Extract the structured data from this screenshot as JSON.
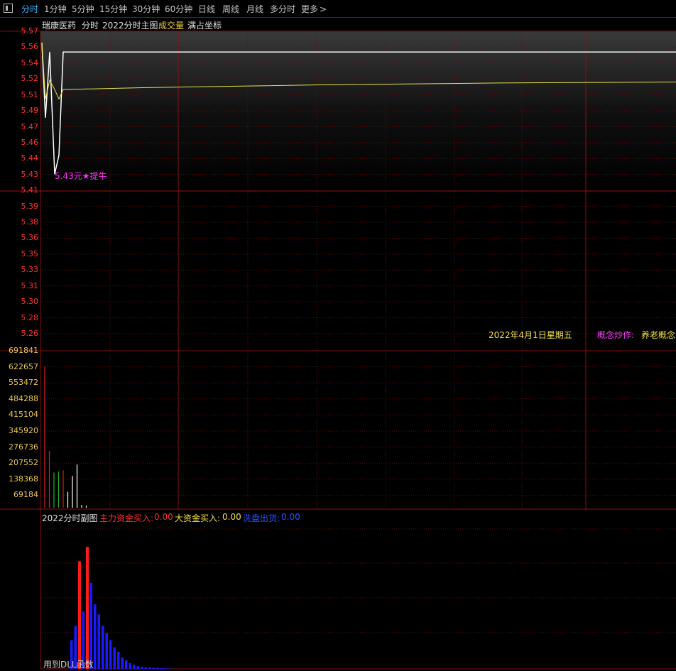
{
  "toolbar": {
    "items": [
      {
        "label": "分时",
        "active": true
      },
      {
        "label": "1分钟"
      },
      {
        "label": "5分钟"
      },
      {
        "label": "15分钟"
      },
      {
        "label": "30分钟"
      },
      {
        "label": "60分钟"
      },
      {
        "label": "日线"
      },
      {
        "label": "周线"
      },
      {
        "label": "月线"
      },
      {
        "label": "多分时"
      },
      {
        "label": "更多"
      }
    ],
    "more_icon": "chevron-right-icon",
    "menu_icon": "window-icon"
  },
  "main_chart": {
    "stock_name": "瑞康医药",
    "mode": "分时",
    "indicator": "2022分时主图",
    "volume_label": "成交量",
    "scale_label": "满占坐标",
    "price_ticks": [
      "5.57",
      "5.56",
      "5.54",
      "5.52",
      "5.51",
      "5.49",
      "5.47",
      "5.46",
      "5.44",
      "5.43",
      "5.41",
      "5.39",
      "5.38",
      "5.36",
      "5.35",
      "5.33",
      "5.31",
      "5.30",
      "5.28",
      "5.26"
    ],
    "low_annotation": "5.43元★提牛",
    "date_text": "2022年4月1日星期五",
    "concept_label": "概念炒作:",
    "concept_value": "养老概念"
  },
  "volume_chart": {
    "ticks": [
      "691841",
      "622657",
      "553472",
      "484288",
      "415104",
      "345920",
      "276736",
      "207552",
      "138368",
      "69184"
    ]
  },
  "sub_chart": {
    "title": "2022分时副图",
    "main_label": "主力资金买入:",
    "main_value": "0.00",
    "big_label": "大资金买入:",
    "big_value": "0.00",
    "wash_label": "洗盘出货:",
    "wash_value": "0.00",
    "footer_text": "用到DLL函数"
  },
  "chart_data": [
    {
      "type": "line",
      "series": [
        {
          "values": [
            5.57,
            5.49,
            5.56,
            5.43,
            5.45,
            5.56,
            5.56,
            5.56,
            5.56,
            5.56
          ]
        },
        {
          "values": [
            5.57,
            5.51,
            5.53,
            5.52,
            5.51,
            5.52,
            5.522,
            5.525,
            5.527,
            5.528
          ]
        }
      ],
      "ylim": [
        5.26,
        5.57
      ]
    },
    {
      "type": "bar",
      "values": [
        622657,
        250000,
        155000,
        160000,
        165000,
        70000,
        140000,
        190000,
        12000,
        8000
      ],
      "colors": [
        "#d42020",
        "#d42020",
        "#20b020",
        "#20b020",
        "#d42020",
        "#ffffff",
        "#ffffff",
        "#ffffff",
        "#ffffff",
        "#ffffff"
      ],
      "ylim": [
        0,
        691841
      ]
    },
    {
      "type": "bar",
      "values": [
        0.2,
        0.3,
        0.75,
        0.4,
        0.85,
        0.6,
        0.45,
        0.38,
        0.3,
        0.25,
        0.2,
        0.15,
        0.12,
        0.08,
        0.06,
        0.04,
        0.03,
        0.02,
        0.015,
        0.01,
        0.01,
        0.008,
        0.006,
        0.005,
        0.004,
        0.003
      ],
      "colors": [
        "#1a1aff",
        "#1a1aff",
        "#ff1a1a",
        "#1a1aff",
        "#ff1a1a",
        "#1a1aff",
        "#1a1aff",
        "#1a1aff",
        "#1a1aff",
        "#1a1aff",
        "#1a1aff",
        "#1a1aff",
        "#1a1aff",
        "#1a1aff",
        "#1a1aff",
        "#1a1aff",
        "#1a1aff",
        "#1a1aff",
        "#1a1aff",
        "#1a1aff",
        "#1a1aff",
        "#1a1aff",
        "#1a1aff",
        "#1a1aff",
        "#1a1aff",
        "#1a1aff"
      ],
      "ylim": [
        0,
        1
      ]
    }
  ],
  "colors": {
    "grid": "#7a1010",
    "price_axis": "#ff3333",
    "volume_axis": "#e8c850",
    "avg_line": "#e8e050",
    "annotation": "#ff30ff"
  }
}
